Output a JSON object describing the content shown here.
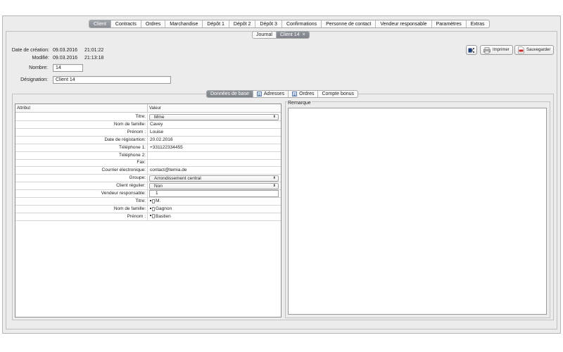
{
  "top_tabs": [
    {
      "label": "Client",
      "active": true
    },
    {
      "label": "Contracts"
    },
    {
      "label": "Ordres"
    },
    {
      "label": "Marchandise"
    },
    {
      "label": "Dépôt 1"
    },
    {
      "label": "Dépôt 2"
    },
    {
      "label": "Dépôt 3"
    },
    {
      "label": "Confirmations"
    },
    {
      "label": "Personne de contact"
    },
    {
      "label": "Vendeur responsable"
    },
    {
      "label": "Paramètres"
    },
    {
      "label": "Extras"
    }
  ],
  "doc_tabs": [
    {
      "label": "Journal"
    },
    {
      "label": "Client 14",
      "active": true,
      "close": "×"
    }
  ],
  "meta": {
    "created_label": "Date de création:",
    "created_date": "09.03.2016",
    "created_time": "21:01:22",
    "modified_label": "Modifié:",
    "modified_date": "09.03.2016",
    "modified_time": "21:13:18"
  },
  "fields": {
    "number_label": "Nombre:",
    "number_value": "14",
    "designation_label": "Désignation:",
    "designation_value": "Client 14"
  },
  "toolbar": {
    "print_label": "Imprimer",
    "save_label": "Sauvegarder"
  },
  "section_tabs": [
    {
      "label": "Données de base",
      "active": true
    },
    {
      "label": "Adresses"
    },
    {
      "label": "Ordres"
    },
    {
      "label": "Compte bonus"
    }
  ],
  "table": {
    "header_attr": "Attribut",
    "header_value": "Valeur",
    "rows": [
      {
        "label": "Titre:",
        "value": "Mme",
        "kind": "select"
      },
      {
        "label": "Nom de famille:",
        "value": "Cavey",
        "kind": "text"
      },
      {
        "label": "Prénom :",
        "value": "Louise",
        "kind": "text"
      },
      {
        "label": "Date de régistartion:",
        "value": "20.02.2016",
        "kind": "text"
      },
      {
        "label": "Téléphone 1:",
        "value": "+331122334455",
        "kind": "text"
      },
      {
        "label": "Téléphone 2:",
        "value": "",
        "kind": "text"
      },
      {
        "label": "Fax:",
        "value": "",
        "kind": "text"
      },
      {
        "label": "Courrier électronique:",
        "value": "contact@temia.de",
        "kind": "text"
      },
      {
        "label": "Groupe:",
        "value": "Arrondissement central",
        "kind": "select"
      },
      {
        "label": "Client régulier:",
        "value": "Non",
        "kind": "select"
      },
      {
        "label": "Vendeur responsable:",
        "value": "1",
        "kind": "spinner"
      },
      {
        "label": "Titre:",
        "value": "M.",
        "kind": "linked"
      },
      {
        "label": "Nom de famille:",
        "value": "Gagnon",
        "kind": "linked"
      },
      {
        "label": "Prénom :",
        "value": "Bastien",
        "kind": "linked"
      }
    ]
  },
  "remark": {
    "title": "Remarque",
    "value": ""
  },
  "colors": {
    "active_tab": "#8a8f96",
    "background": "#ececec"
  }
}
